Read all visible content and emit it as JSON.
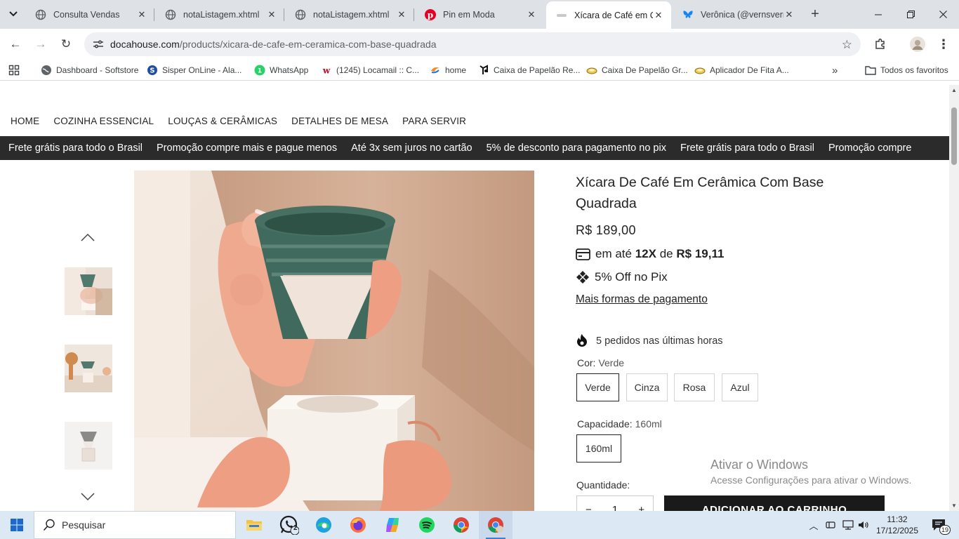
{
  "browser": {
    "tabs": [
      {
        "title": "Consulta Vendas",
        "icon": "globe-icon"
      },
      {
        "title": "notaListagem.xhtml",
        "icon": "globe-icon"
      },
      {
        "title": "notaListagem.xhtml",
        "icon": "globe-icon"
      },
      {
        "title": "Pin em Moda",
        "icon": "pinterest-icon"
      },
      {
        "title": "Xícara de Café em Ce",
        "icon": "docahouse-icon",
        "active": true
      },
      {
        "title": "Verônica (@vernsverr",
        "icon": "bluesky-icon"
      }
    ],
    "url_host": "docahouse.com",
    "url_path": "/products/xicara-de-cafe-em-ceramica-com-base-quadrada",
    "bookmarks": [
      {
        "label": "Dashboard - Softstore",
        "icon": "globe-icon"
      },
      {
        "label": "Sisper OnLine - Ala...",
        "icon": "sisper-icon"
      },
      {
        "label": "WhatsApp",
        "icon": "whatsapp-icon"
      },
      {
        "label": "(1245) Locamail :: C...",
        "icon": "locamail-icon"
      },
      {
        "label": "home",
        "icon": "home-icon"
      },
      {
        "label": "Caixa de Papelão Re...",
        "icon": "caixa-icon"
      },
      {
        "label": "Caixa De Papelão Gr...",
        "icon": "box-icon"
      },
      {
        "label": "Aplicador De Fita A...",
        "icon": "tape-icon"
      }
    ],
    "all_bookmarks": "Todos os favoritos"
  },
  "site": {
    "nav": [
      "HOME",
      "COZINHA ESSENCIAL",
      "LOUÇAS & CERÂMICAS",
      "DETALHES DE MESA",
      "PARA SERVIR"
    ],
    "promo": [
      "Frete grátis para todo o Brasil",
      "Promoção compre mais e pague menos",
      "Até 3x sem juros no cartão",
      "5% de desconto para pagamento no pix",
      "Frete grátis para todo o Brasil",
      "Promoção compre"
    ]
  },
  "product": {
    "title": "Xícara De Café Em Cerâmica Com Base Quadrada",
    "price": "R$ 189,00",
    "installment_prefix": "em até",
    "installment_count": "12X",
    "installment_mid": "de",
    "installment_value": "R$ 19,11",
    "pix": "5% Off no Pix",
    "more_payment": "Mais formas de pagamento",
    "orders": "5 pedidos nas últimas horas",
    "color_label": "Cor:",
    "color_value": "Verde",
    "colors": [
      "Verde",
      "Cinza",
      "Rosa",
      "Azul"
    ],
    "capacity_label": "Capacidade:",
    "capacity_value": "160ml",
    "capacities": [
      "160ml"
    ],
    "quantity_label": "Quantidade:",
    "quantity_value": "1",
    "qty_minus": "−",
    "qty_plus": "+",
    "add_to_cart": "ADICIONAR AO CARRINHO"
  },
  "windows": {
    "activate_title": "Ativar o Windows",
    "activate_sub": "Acesse Configurações para ativar o Windows.",
    "search_placeholder": "Pesquisar",
    "whatsapp_badge": "2",
    "time": "11:32",
    "date": "17/12/2025",
    "notif_count": "19"
  }
}
